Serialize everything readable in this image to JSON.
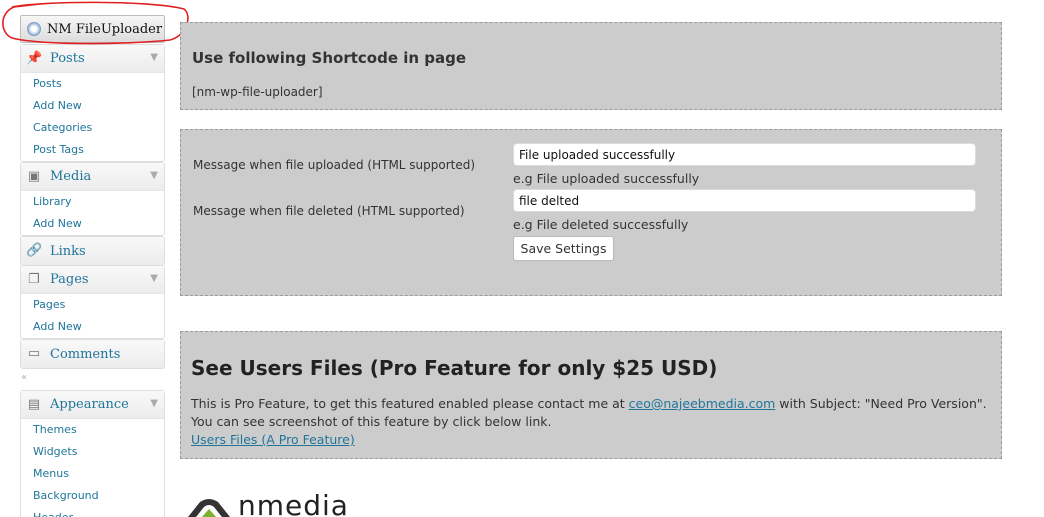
{
  "sidebar": {
    "plugin_button": "NM FileUploader",
    "posts": {
      "label": "Posts",
      "items": [
        "Posts",
        "Add New",
        "Categories",
        "Post Tags"
      ]
    },
    "media": {
      "label": "Media",
      "items": [
        "Library",
        "Add New"
      ]
    },
    "links": {
      "label": "Links"
    },
    "pages": {
      "label": "Pages",
      "items": [
        "Pages",
        "Add New"
      ]
    },
    "comments": {
      "label": "Comments"
    },
    "appearance": {
      "label": "Appearance",
      "items": [
        "Themes",
        "Widgets",
        "Menus",
        "Background",
        "Header"
      ]
    },
    "arrow_glyph": "▼",
    "collapse_glyph": "«"
  },
  "shortcode_panel": {
    "title": "Use following Shortcode in page",
    "shortcode": "[nm-wp-file-uploader]"
  },
  "settings_panel": {
    "upload_label": "Message when file uploaded (HTML supported)",
    "upload_value": "File uploaded successfully",
    "upload_hint": "e.g File uploaded successfully",
    "delete_label": "Message when file deleted (HTML supported)",
    "delete_value": "file delted",
    "delete_hint": "e.g File deleted successfully",
    "save_button": "Save Settings"
  },
  "pro_panel": {
    "title": "See Users Files (Pro Feature for only $25 USD)",
    "desc_before": "This is Pro Feature, to get this featured enabled please contact me at ",
    "email": "ceo@najeebmedia.com",
    "desc_after": " with Subject: \"Need Pro Version\". You can see screenshot of this feature by click below link.",
    "link": "Users Files (A Pro Feature)"
  },
  "logo": {
    "text": "nmedia"
  },
  "colors": {
    "link": "#21759b",
    "panel_bg": "#cccccc",
    "annotation": "#e02020"
  }
}
